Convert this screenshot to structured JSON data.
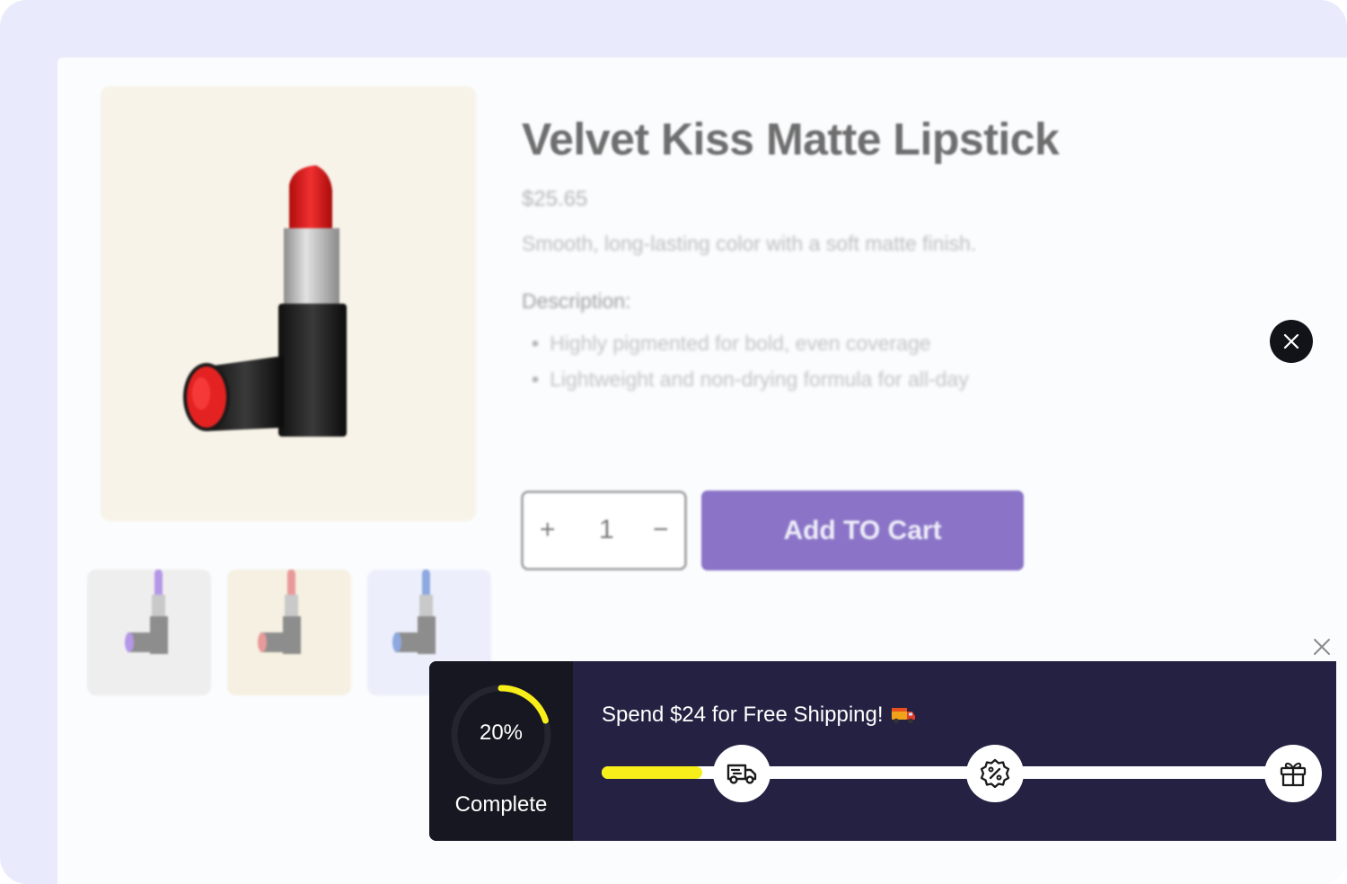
{
  "product": {
    "title": "Velvet Kiss Matte Lipstick",
    "price": "$25.65",
    "tagline": "Smooth, long-lasting color with a soft matte finish.",
    "description_label": "Description:",
    "bullets": [
      "Highly pigmented for bold, even coverage",
      "Lightweight and non-drying formula for all-day"
    ],
    "quantity": "1",
    "plus_label": "+",
    "minus_label": "−",
    "add_to_cart_label": "Add TO Cart",
    "accent_color": "#8b74c8",
    "thumbnail_colors": [
      "#b597e8",
      "#e89a9a",
      "#8ea8e0"
    ]
  },
  "shipping_banner": {
    "progress_percent": 20,
    "progress_text": "20%",
    "progress_label": "Complete",
    "headline": "Spend $24 for Free Shipping!",
    "bar_fill_fraction": 0.145,
    "milestones": [
      "truck-icon",
      "discount-badge-icon",
      "gift-icon"
    ],
    "progress_color": "#f7ee1a",
    "background_color": "#252142"
  },
  "icons": {
    "modal_close": "close-icon",
    "banner_close": "close-icon"
  }
}
